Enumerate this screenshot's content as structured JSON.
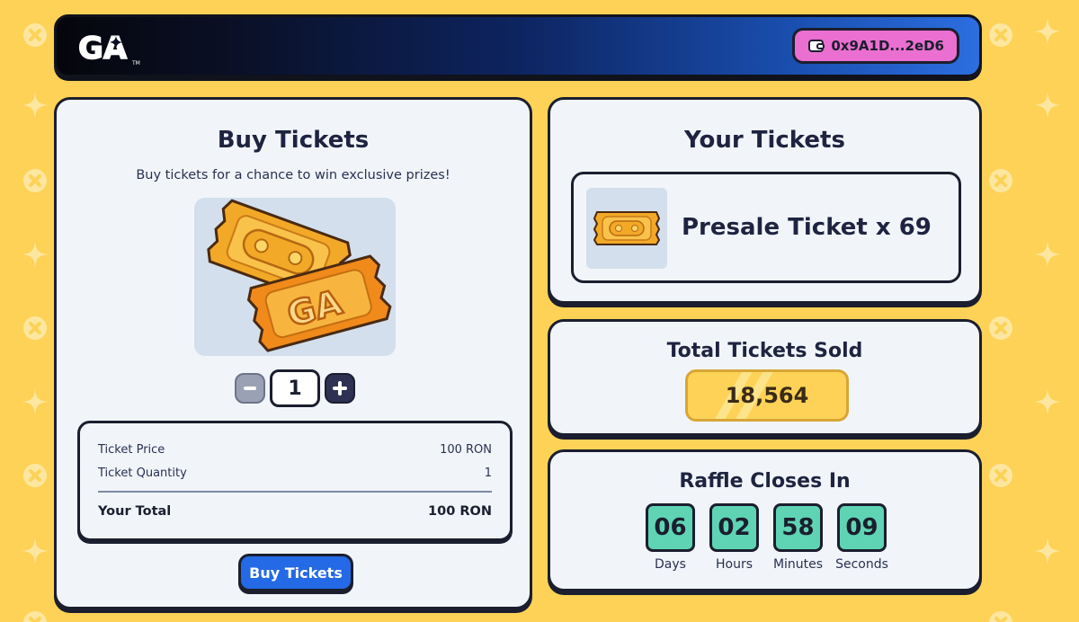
{
  "header": {
    "logo_text": "GA",
    "logo_tm": "TM",
    "wallet_address": "0x9A1D...2eD6"
  },
  "buy": {
    "title": "Buy Tickets",
    "subtitle": "Buy tickets for a chance to win exclusive prizes!",
    "ticket_image_letters": "GA",
    "quantity": "1",
    "minus_label": "−",
    "plus_label": "+",
    "summary": {
      "price_label": "Ticket Price",
      "price_value": "100 RON",
      "quantity_label": "Ticket Quantity",
      "quantity_value": "1",
      "total_label": "Your Total",
      "total_value": "100 RON"
    },
    "button_label": "Buy Tickets"
  },
  "your_tickets": {
    "title": "Your Tickets",
    "ticket_label": "Presale Ticket x 69"
  },
  "total_sold": {
    "title": "Total Tickets Sold",
    "value": "18,564"
  },
  "countdown": {
    "title": "Raffle Closes In",
    "units": [
      {
        "value": "06",
        "label": "Days"
      },
      {
        "value": "02",
        "label": "Hours"
      },
      {
        "value": "58",
        "label": "Minutes"
      },
      {
        "value": "09",
        "label": "Seconds"
      }
    ]
  },
  "colors": {
    "background": "#fdd257",
    "panel": "#f1f5fa",
    "outline": "#1b1e2e",
    "wallet_pink": "#ea6fd0",
    "button_blue": "#2469e6",
    "countdown_teal": "#5fd4b4",
    "ticket_orange": "#f0a020"
  },
  "icons": [
    "wallet-icon",
    "minus-icon",
    "plus-icon",
    "ticket-icon",
    "logo-icon"
  ]
}
